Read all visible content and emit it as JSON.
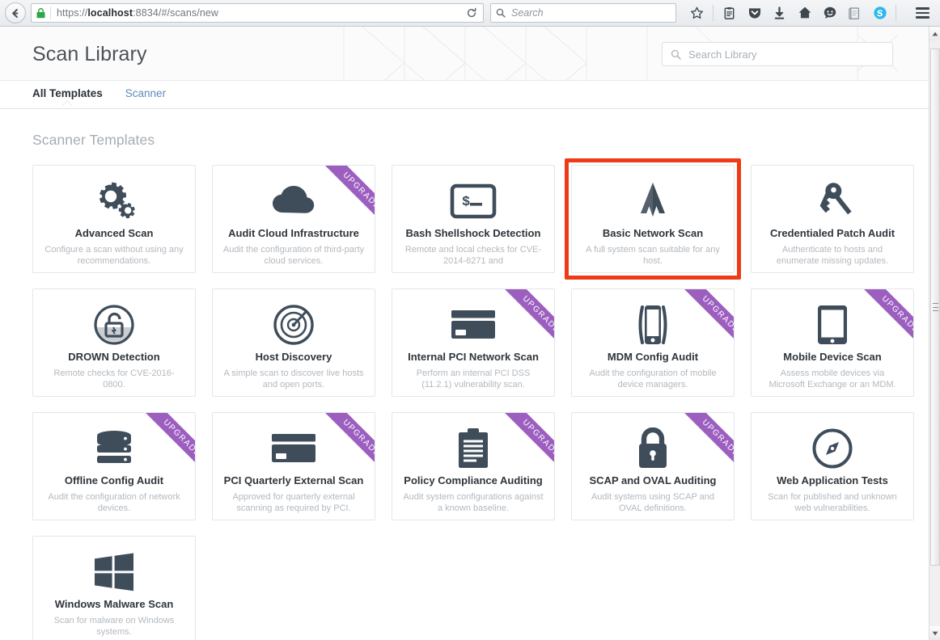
{
  "browser": {
    "back_label": "back-arrow",
    "lock_label": "secure-lock",
    "url_prefix": "https://",
    "url_host": "localhost",
    "url_suffix": ":8834/#/scans/new",
    "url_full": "https://localhost:8834/#/scans/new",
    "reload_label": "reload",
    "search_placeholder": "Search",
    "toolbar_icons": [
      {
        "name": "bookmark-star-icon",
        "label": "Bookmark this page"
      },
      {
        "name": "reading-list-icon",
        "label": "Reading list"
      },
      {
        "name": "pocket-icon",
        "label": "Save to Pocket"
      },
      {
        "name": "downloads-icon",
        "label": "Downloads"
      },
      {
        "name": "home-icon",
        "label": "Home"
      },
      {
        "name": "feedback-smiley-icon",
        "label": "Feedback"
      },
      {
        "name": "reader-mode-icon",
        "label": "Reader"
      },
      {
        "name": "skype-icon",
        "label": "Skype"
      }
    ],
    "menu_label": "Open menu"
  },
  "header": {
    "title": "Scan Library",
    "search_placeholder": "Search Library",
    "search_value": ""
  },
  "tabs": [
    {
      "label": "All Templates",
      "active": true
    },
    {
      "label": "Scanner",
      "active": false
    }
  ],
  "section": {
    "title": "Scanner Templates"
  },
  "colors": {
    "upgrade_ribbon": "#9c5fc0",
    "highlight_border": "#ee3a16",
    "icon": "#3f4d5b",
    "tab_link": "#5c8bbd"
  },
  "highlight": {
    "target": "Basic Network Scan",
    "label": "selected-template-highlight"
  },
  "ribbon_label": "UPGRADE",
  "templates": [
    {
      "title": "Advanced Scan",
      "description": "Configure a scan without using any recommendations.",
      "icon": "gears-icon",
      "upgrade": false
    },
    {
      "title": "Audit Cloud Infrastructure",
      "description": "Audit the configuration of third-party cloud services.",
      "icon": "cloud-icon",
      "upgrade": true
    },
    {
      "title": "Bash Shellshock Detection",
      "description": "Remote and local checks for CVE-2014-6271 and",
      "icon": "terminal-icon",
      "upgrade": false
    },
    {
      "title": "Basic Network Scan",
      "description": "A full system scan suitable for any host.",
      "icon": "pulse-icon",
      "upgrade": false
    },
    {
      "title": "Credentialed Patch Audit",
      "description": "Authenticate to hosts and enumerate missing updates.",
      "icon": "keys-icon",
      "upgrade": false
    },
    {
      "title": "DROWN Detection",
      "description": "Remote checks for CVE-2016-0800.",
      "icon": "unlocked-padlock-circle-icon",
      "upgrade": false
    },
    {
      "title": "Host Discovery",
      "description": "A simple scan to discover live hosts and open ports.",
      "icon": "radar-target-icon",
      "upgrade": false
    },
    {
      "title": "Internal PCI Network Scan",
      "description": "Perform an internal PCI DSS (11.2.1) vulnerability scan.",
      "icon": "credit-card-icon",
      "upgrade": true
    },
    {
      "title": "MDM Config Audit",
      "description": "Audit the configuration of mobile device managers.",
      "icon": "mobile-phone-icon",
      "upgrade": true
    },
    {
      "title": "Mobile Device Scan",
      "description": "Assess mobile devices via Microsoft Exchange or an MDM.",
      "icon": "tablet-icon",
      "upgrade": true
    },
    {
      "title": "Offline Config Audit",
      "description": "Audit the configuration of network devices.",
      "icon": "server-stack-icon",
      "upgrade": true
    },
    {
      "title": "PCI Quarterly External Scan",
      "description": "Approved for quarterly external scanning as required by PCI.",
      "icon": "credit-card-icon",
      "upgrade": true
    },
    {
      "title": "Policy Compliance Auditing",
      "description": "Audit system configurations against a known baseline.",
      "icon": "clipboard-icon",
      "upgrade": true
    },
    {
      "title": "SCAP and OVAL Auditing",
      "description": "Audit systems using SCAP and OVAL definitions.",
      "icon": "padlock-icon",
      "upgrade": true
    },
    {
      "title": "Web Application Tests",
      "description": "Scan for published and unknown web vulnerabilities.",
      "icon": "compass-icon",
      "upgrade": false
    },
    {
      "title": "Windows Malware Scan",
      "description": "Scan for malware on Windows systems.",
      "icon": "windows-logo-icon",
      "upgrade": false
    }
  ]
}
